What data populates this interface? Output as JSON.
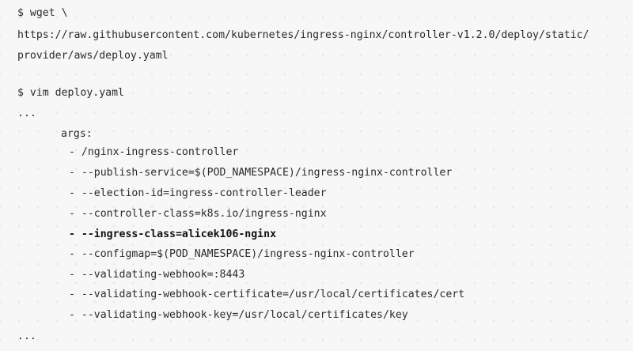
{
  "code": {
    "lines": [
      "$ wget \\",
      "https://raw.githubusercontent.com/kubernetes/ingress-nginx/controller-v1.2.0/deploy/static/",
      "provider/aws/deploy.yaml",
      "",
      "$ vim deploy.yaml",
      "...",
      "args:",
      "- /nginx-ingress-controller",
      "- --publish-service=$(POD_NAMESPACE)/ingress-nginx-controller",
      "- --election-id=ingress-controller-leader",
      "- --controller-class=k8s.io/ingress-nginx",
      "- --ingress-class=alicek106-nginx",
      "- --configmap=$(POD_NAMESPACE)/ingress-nginx-controller",
      "- --validating-webhook=:8443",
      "- --validating-webhook-certificate=/usr/local/certificates/cert",
      "- --validating-webhook-key=/usr/local/certificates/key",
      "..."
    ]
  }
}
